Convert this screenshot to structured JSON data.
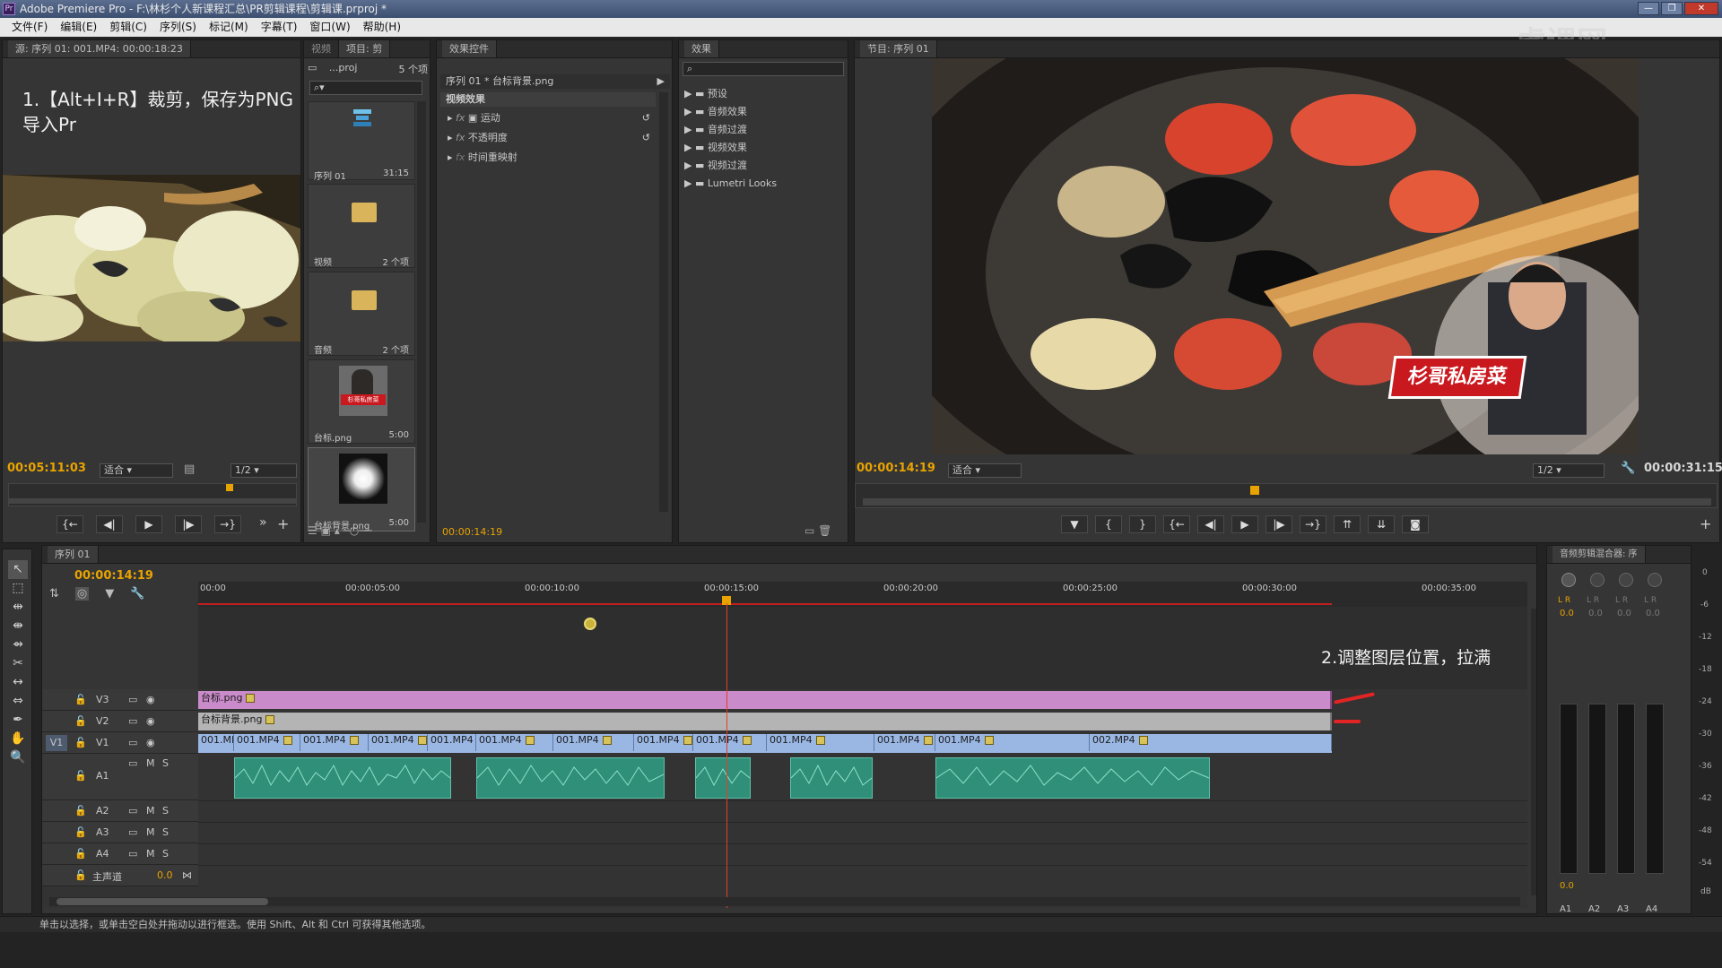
{
  "window": {
    "title": "Adobe Premiere Pro - F:\\林杉个人新课程汇总\\PR剪辑课程\\剪辑课.prproj *",
    "buttons": [
      "—",
      "❐",
      "✕"
    ]
  },
  "menu": [
    "文件(F)",
    "编辑(E)",
    "剪辑(C)",
    "序列(S)",
    "标记(M)",
    "字幕(T)",
    "窗口(W)",
    "帮助(H)"
  ],
  "source": {
    "tab": "源: 序列 01: 001.MP4: 00:00:18:23",
    "instruction_line1": "1.【Alt+I+R】裁剪，保存为PNG",
    "instruction_line2": "导入Pr",
    "timecode": "00:05:11:03",
    "fit": "适合",
    "resolution": "1/2"
  },
  "project": {
    "tabs": [
      "视频",
      "项目: 剪"
    ],
    "path": "...proj",
    "count": "5 个项",
    "items": [
      {
        "name": "序列 01",
        "meta": "31:15"
      },
      {
        "name": "视频",
        "meta": "2 个项"
      },
      {
        "name": "音频",
        "meta": "2 个项"
      },
      {
        "name": "台标.png",
        "meta": "5:00"
      },
      {
        "name": "台标背景.png",
        "meta": "5:00"
      }
    ],
    "thumb_text": "杉哥私房菜"
  },
  "effect_controls": {
    "tab": "效果控件",
    "clip": "序列 01 * 台标背景.png",
    "section": "视频效果",
    "rows": [
      "运动",
      "不透明度",
      "时间重映射"
    ],
    "timecode": "00:00:14:19"
  },
  "effects": {
    "tab": "效果",
    "folders": [
      "预设",
      "音频效果",
      "音频过渡",
      "视频效果",
      "视频过渡",
      "Lumetri Looks"
    ]
  },
  "program": {
    "tab": "节目: 序列 01",
    "timecode": "00:00:14:19",
    "fit": "适合",
    "resolution": "1/2",
    "duration": "00:00:31:15",
    "banner": "杉哥私房菜"
  },
  "timeline": {
    "tab": "序列 01",
    "timecode": "00:00:14:19",
    "ruler": [
      "00:00",
      "00:00:05:00",
      "00:00:10:00",
      "00:00:15:00",
      "00:00:20:00",
      "00:00:25:00",
      "00:00:30:00",
      "00:00:35:00"
    ],
    "annotation": "2.调整图层位置，拉满",
    "tracks": [
      "V3",
      "V2",
      "V1",
      "A1",
      "A2",
      "A3",
      "A4"
    ],
    "master": "主声道",
    "master_val": "0.0",
    "v3_clip": "台标.png",
    "v2_clip": "台标背景.png",
    "v1_clips": [
      "001.MP",
      "001.MP4",
      "001.MP4",
      "001.MP4",
      "001.MP4",
      "001.MP4",
      "001.MP4",
      "001.MP4",
      "001.MP4",
      "001.MP4",
      "001.MP4",
      "001.MP4",
      "002.MP4"
    ],
    "v1_label": "V1",
    "ms": [
      "M",
      "S"
    ]
  },
  "mixer": {
    "tab": "音频剪辑混合器: 序",
    "channels": [
      "A1",
      "A2",
      "A3",
      "A4"
    ],
    "values": [
      "0.0",
      "0.0",
      "0.0",
      "0.0"
    ],
    "bottom_val": "0.0",
    "lr": [
      "L",
      "R"
    ],
    "scale": [
      "0",
      "-6",
      "-12",
      "-18",
      "-24",
      "-30",
      "-36",
      "-42",
      "-48",
      "-54",
      "dB"
    ]
  },
  "status": "单击以选择，或单击空白处并拖动以进行框选。使用 Shift、Alt 和 Ctrl 可获得其他选项。",
  "watermark": "虎课网"
}
